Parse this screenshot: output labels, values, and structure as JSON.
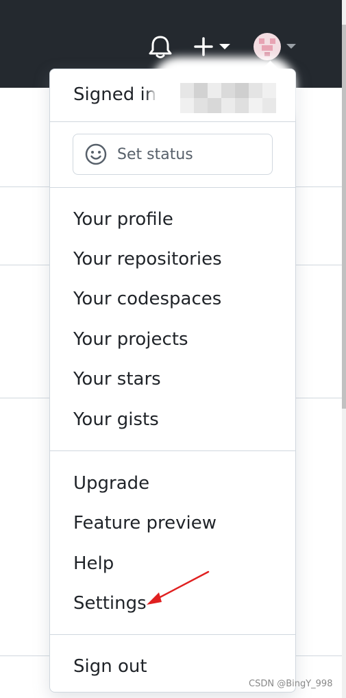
{
  "header": {
    "notifications_icon": "bell-icon",
    "create_icon": "plus-icon",
    "avatar_icon": "avatar-icon",
    "accent_color": "#24292f"
  },
  "dropdown": {
    "signed_in_prefix": "Signed in",
    "status_button": {
      "icon": "smiley-icon",
      "label": "Set status"
    },
    "section_personal": [
      "Your profile",
      "Your repositories",
      "Your codespaces",
      "Your projects",
      "Your stars",
      "Your gists"
    ],
    "section_misc": [
      "Upgrade",
      "Feature preview",
      "Help",
      "Settings"
    ],
    "sign_out": "Sign out"
  },
  "annotation": {
    "arrow_color": "#e02020",
    "target": "Settings"
  },
  "watermark": "CSDN @BingY_998"
}
